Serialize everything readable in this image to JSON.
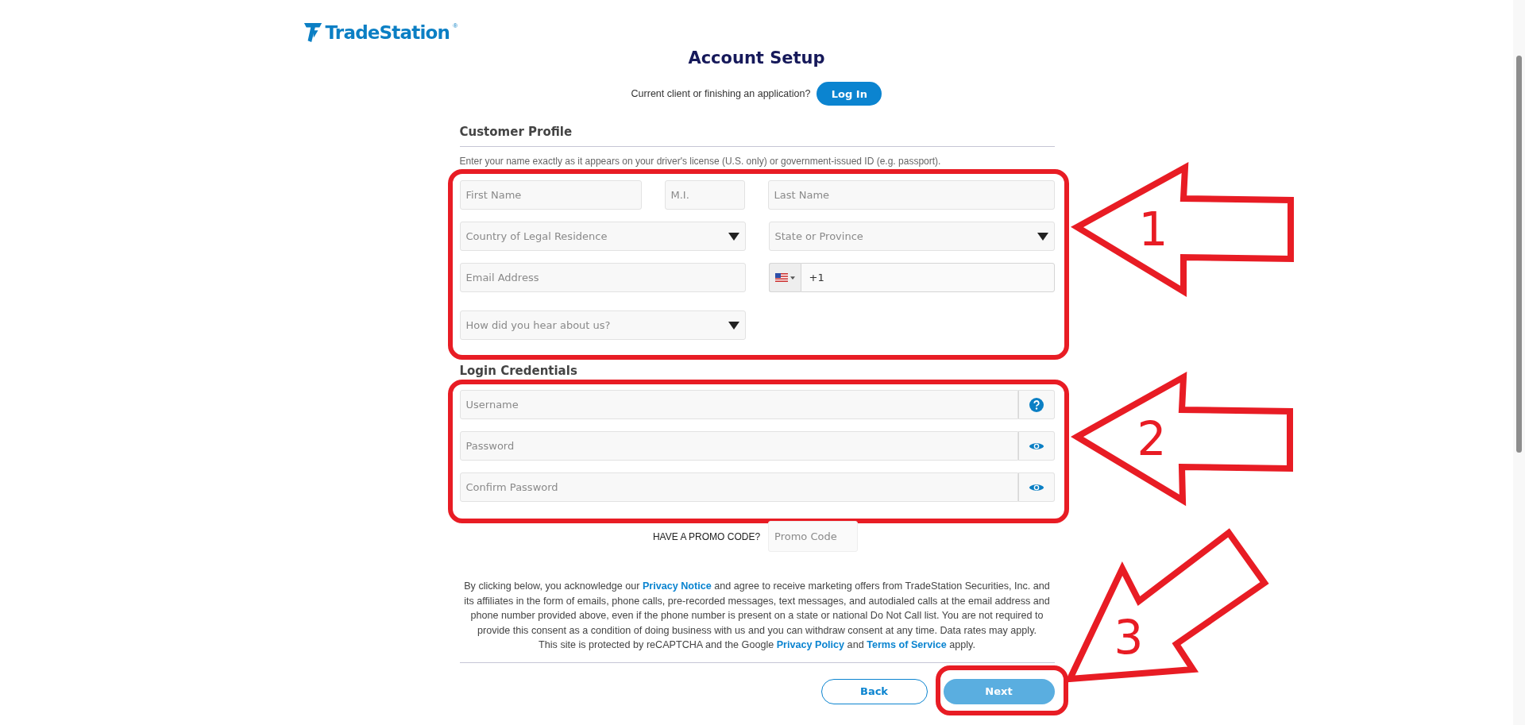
{
  "logo": {
    "name": "TradeStation",
    "mark": "®"
  },
  "title": "Account Setup",
  "login_prompt": {
    "text": "Current client or finishing an application?",
    "button": "Log In"
  },
  "customer_profile": {
    "heading": "Customer Profile",
    "instruction": "Enter your name exactly as it appears on your driver's license (U.S. only) or government-issued ID (e.g. passport).",
    "annotation": "1",
    "rows": [
      [
        {
          "kind": "text",
          "placeholder": "First Name"
        },
        {
          "kind": "text",
          "placeholder": "M.I."
        },
        {
          "kind": "text",
          "placeholder": "Last Name"
        }
      ],
      [
        {
          "kind": "select",
          "placeholder": "Country of Legal Residence"
        },
        {
          "kind": "select",
          "placeholder": "State or Province"
        }
      ],
      [
        {
          "kind": "text",
          "placeholder": "Email Address"
        },
        {
          "kind": "phone",
          "value": "+1"
        }
      ],
      [
        {
          "kind": "select",
          "placeholder": "How did you hear about us?"
        }
      ]
    ]
  },
  "login_credentials": {
    "heading": "Login Credentials",
    "annotation": "2",
    "fields": [
      {
        "kind": "help",
        "placeholder": "Username"
      },
      {
        "kind": "reveal",
        "placeholder": "Password"
      },
      {
        "kind": "reveal",
        "placeholder": "Confirm Password"
      }
    ]
  },
  "promo": {
    "label": "HAVE A PROMO CODE?",
    "placeholder": "Promo Code"
  },
  "consent": [
    [
      {
        "kind": "text",
        "text": "By clicking below, you acknowledge our "
      },
      {
        "kind": "link",
        "text": "Privacy Notice"
      },
      {
        "kind": "text",
        "text": " and agree to receive marketing offers from TradeStation Securities, Inc. and its affiliates in the form of emails, phone calls, pre-recorded messages, text messages, and autodialed calls at the email address and phone number provided above, even if the phone number is present on a state or national Do Not Call list. You are not required to provide this consent as a condition of doing business with us and you can withdraw consent at any time. Data rates may apply."
      }
    ],
    [
      {
        "kind": "text",
        "text": "This site is protected by reCAPTCHA and the Google "
      },
      {
        "kind": "link",
        "text": "Privacy Policy"
      },
      {
        "kind": "text",
        "text": " and "
      },
      {
        "kind": "link",
        "text": "Terms of Service"
      },
      {
        "kind": "text",
        "text": " apply."
      }
    ]
  ],
  "buttons": [
    {
      "label": "Back",
      "kind": "secondary",
      "disabled": false
    },
    {
      "label": "Next",
      "kind": "primary",
      "disabled": true,
      "annotation": "3"
    }
  ]
}
